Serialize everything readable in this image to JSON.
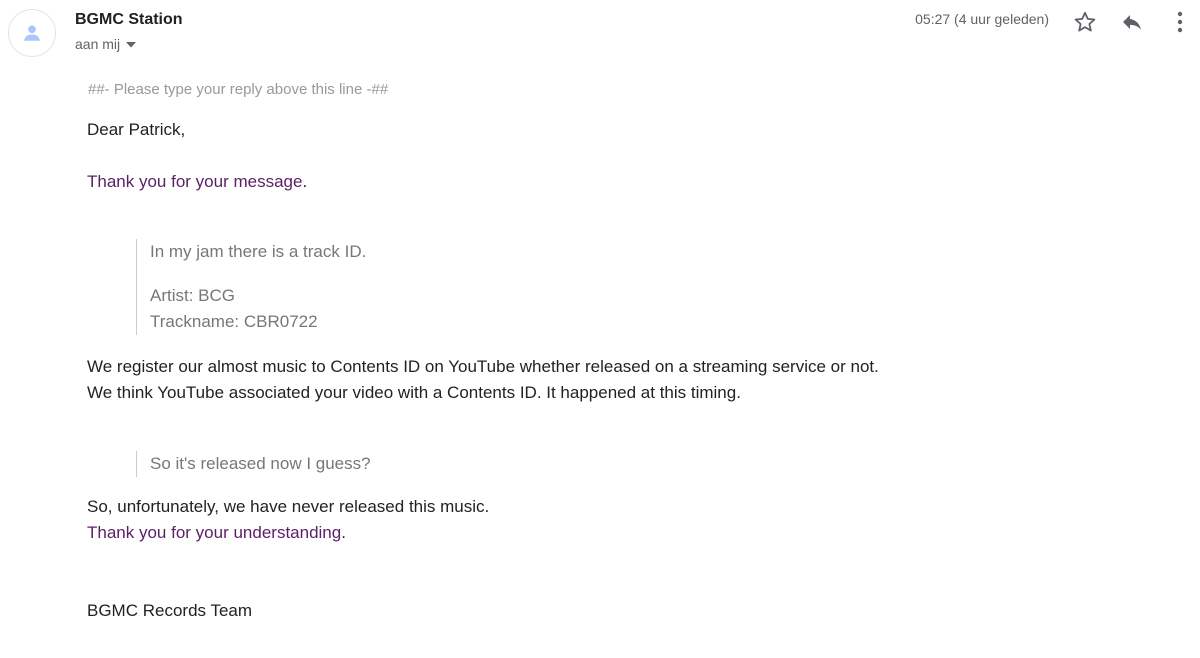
{
  "header": {
    "sender_name": "BGMC Station",
    "recipient_label": "aan mij",
    "timestamp": "05:27 (4 uur geleden)",
    "icons": {
      "avatar": "person-icon",
      "recipient_toggle": "caret-down-icon",
      "star": "star-outline-icon",
      "reply": "reply-icon",
      "more": "more-vertical-icon"
    }
  },
  "message": {
    "reply_marker": "##- Please type your reply above this line -##",
    "greeting": "Dear Patrick,",
    "thanks_text": "Thank you for your message",
    "thanks_period": ".",
    "quote1": {
      "line1": "In my jam there is a track ID.",
      "line2": "Artist: BCG",
      "line3": "Trackname: CBR0722"
    },
    "para1_line1": "We register our almost music to Contents ID on YouTube whether released on a streaming service or not.",
    "para1_line2": "We think YouTube associated your video with a Contents ID. It happened at this timing.",
    "quote2": "So it's released now I guess?",
    "closing_line1": "So, unfortunately, we have never released this music.",
    "closing_thanks": "Thank you for your understanding",
    "closing_period": ".",
    "signature": "BGMC Records Team"
  },
  "colors": {
    "link_purple": "#5b1f66",
    "body_text": "#222222",
    "quote_text": "#777777",
    "muted": "#5f6368"
  }
}
